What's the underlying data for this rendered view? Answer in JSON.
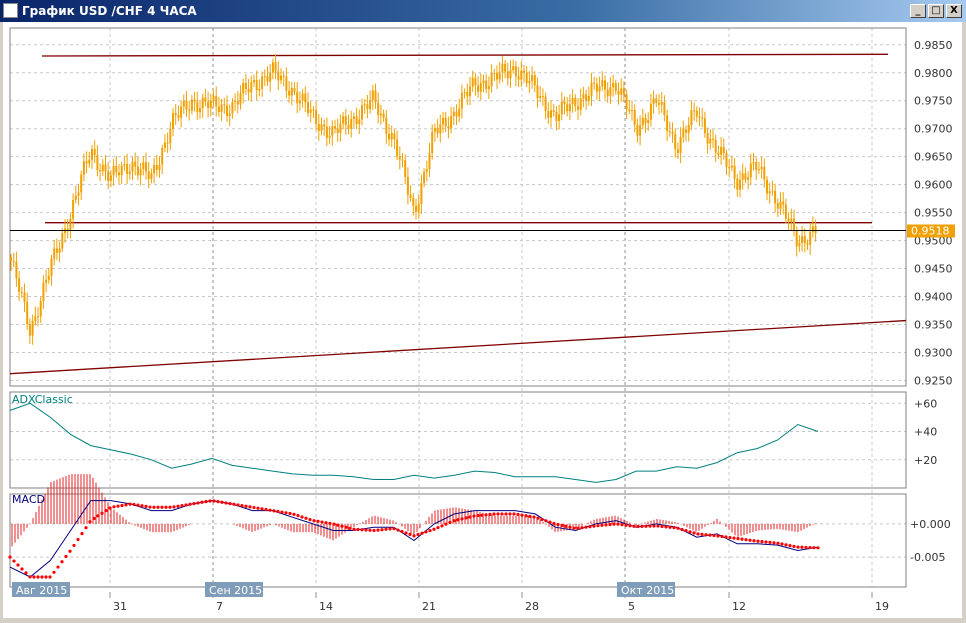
{
  "window": {
    "title": "График USD /CHF  4 ЧАСА",
    "buttons": {
      "minimize": "_",
      "maximize": "□",
      "close": "X"
    }
  },
  "colors": {
    "candle": "#f0a000",
    "trendline": "#800000",
    "adx": "#008080",
    "macd_main": "#000080",
    "macd_signal": "#ff0000",
    "price_tag": "#f0a000",
    "month_tag": "#7f9db9"
  },
  "current_price": "0.9518",
  "chart_data": [
    {
      "type": "candlestick",
      "title": "USD/CHF 4H",
      "y_ticks": [
        "0.9850",
        "0.9800",
        "0.9750",
        "0.9700",
        "0.9650",
        "0.9600",
        "0.9550",
        "0.9500",
        "0.9450",
        "0.9400",
        "0.9350",
        "0.9300",
        "0.9250"
      ],
      "ylim": [
        0.924,
        0.988
      ],
      "x_ticks": [
        "31",
        "7",
        "14",
        "21",
        "28",
        "5",
        "12",
        "19"
      ],
      "month_labels": [
        "Авг 2015",
        "Сен 2015",
        "Окт 2015"
      ],
      "closes": [
        0.947,
        0.934,
        0.945,
        0.955,
        0.966,
        0.961,
        0.964,
        0.961,
        0.971,
        0.975,
        0.974,
        0.974,
        0.978,
        0.98,
        0.977,
        0.972,
        0.969,
        0.972,
        0.975,
        0.968,
        0.955,
        0.969,
        0.973,
        0.978,
        0.979,
        0.981,
        0.977,
        0.972,
        0.975,
        0.977,
        0.978,
        0.97,
        0.975,
        0.967,
        0.973,
        0.966,
        0.961,
        0.963,
        0.957,
        0.95,
        0.9518
      ],
      "trendlines": [
        {
          "name": "resistance",
          "start": 0.983,
          "end": 0.9833
        },
        {
          "name": "support-horizontal",
          "start": 0.9532,
          "end": 0.9532
        },
        {
          "name": "rising-support",
          "start": 0.9262,
          "end": 0.9357
        }
      ]
    },
    {
      "type": "line",
      "title": "ADXClassic",
      "y_ticks": [
        "+60",
        "+40",
        "+20"
      ],
      "ylim": [
        0,
        68
      ],
      "values": [
        55,
        60,
        50,
        38,
        30,
        27,
        24,
        20,
        14,
        17,
        21,
        16,
        14,
        12,
        10,
        9,
        9,
        8,
        6,
        6,
        9,
        7,
        9,
        12,
        11,
        8,
        8,
        8,
        6,
        4,
        6,
        12,
        12,
        15,
        14,
        18,
        25,
        28,
        34,
        45,
        40
      ]
    },
    {
      "type": "line",
      "title": "MACD",
      "y_ticks": [
        "+0.000",
        "-0.005"
      ],
      "ylim": [
        -0.0095,
        0.0045
      ],
      "series": [
        {
          "name": "main",
          "values": [
            -0.0065,
            -0.008,
            -0.0055,
            -0.001,
            0.0035,
            0.0035,
            0.003,
            0.002,
            0.002,
            0.003,
            0.0035,
            0.003,
            0.002,
            0.002,
            0.001,
            0,
            -0.001,
            -0.001,
            -0.0005,
            -0.0005,
            -0.0025,
            0,
            0.0015,
            0.002,
            0.002,
            0.002,
            0.0015,
            -0.0005,
            -0.001,
            0,
            0.0005,
            -0.0005,
            0,
            -0.0005,
            -0.002,
            -0.0015,
            -0.003,
            -0.003,
            -0.0032,
            -0.004,
            -0.0035
          ]
        },
        {
          "name": "signal",
          "values": [
            -0.005,
            -0.008,
            -0.008,
            -0.004,
            0.0005,
            0.0025,
            0.003,
            0.0025,
            0.0025,
            0.003,
            0.0035,
            0.003,
            0.0025,
            0.002,
            0.0015,
            0.0005,
            0,
            -0.0008,
            -0.001,
            -0.0007,
            -0.0018,
            -0.0008,
            0.0005,
            0.0012,
            0.0015,
            0.0015,
            0.001,
            0,
            -0.0007,
            -0.0003,
            0,
            -0.0004,
            -0.0003,
            -0.0006,
            -0.0015,
            -0.0018,
            -0.0022,
            -0.0026,
            -0.0029,
            -0.0035,
            -0.0036
          ]
        }
      ]
    }
  ]
}
